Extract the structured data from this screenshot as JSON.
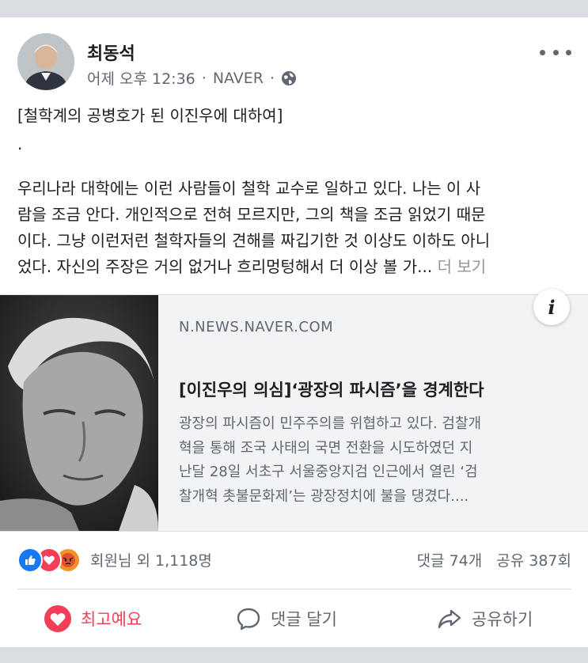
{
  "post": {
    "author": "최동석",
    "time": "어제 오후 12:36",
    "source": "NAVER",
    "sep": "·",
    "title": "[철학계의 공병호가 된 이진우에 대하여]",
    "dot": ".",
    "body_lines": [
      "우리나라 대학에는 이런 사람들이 철학 교수로 일하고 있다. 나는 이 사",
      "람을 조금 안다. 개인적으로 전혀 모르지만, 그의 책을 조금 읽었기 때문",
      "이다. 그냥 이런저런 철학자들의 견해를 짜깁기한 것 이상도 이하도 아니",
      "었다. 자신의 주장은 거의 없거나 흐리멍텅해서 더 이상 볼 가..."
    ],
    "see_more": "더 보기"
  },
  "link": {
    "domain": "N.NEWS.NAVER.COM",
    "title": "[이진우의 의심]‘광장의 파시즘’을 경계한다",
    "desc_lines": [
      "광장의 파시즘이 민주주의를 위협하고 있다. 검찰개",
      "혁을 통해 조국 사태의 국면 전환을 시도하였던 지",
      "난달 28일 서초구 서울중앙지검 인근에서 열린 ‘검",
      "찰개혁 촛불문화제’는 광장정치에 불을 댕겼다...."
    ],
    "info": "i"
  },
  "stats": {
    "reactions_text": "회원님 외 1,118명",
    "comments": "댓글 74개",
    "shares": "공유 387회",
    "reaction_icons": [
      "like-icon",
      "love-icon",
      "angry-icon"
    ]
  },
  "actions": {
    "like": "최고예요",
    "comment": "댓글 달기",
    "share": "공유하기"
  },
  "colors": {
    "love": "#f33e58",
    "like": "#1877f2",
    "angry": "#f0932b",
    "secondary_text": "#606770"
  }
}
